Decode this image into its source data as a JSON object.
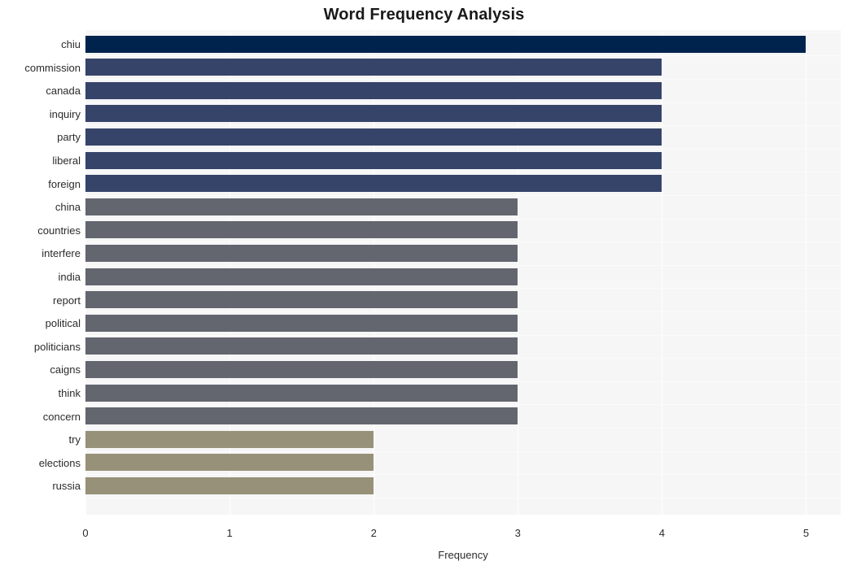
{
  "chart_data": {
    "type": "bar",
    "orientation": "horizontal",
    "title": "Word Frequency Analysis",
    "xlabel": "Frequency",
    "ylabel": "",
    "xlim": [
      0,
      5.24
    ],
    "xticks": [
      "0",
      "1",
      "2",
      "3",
      "4",
      "5"
    ],
    "xtick_values": [
      0,
      1,
      2,
      3,
      4,
      5
    ],
    "grid": true,
    "grid_axis": "both",
    "legend": "none",
    "categories": [
      "chiu",
      "commission",
      "canada",
      "inquiry",
      "party",
      "liberal",
      "foreign",
      "china",
      "countries",
      "interfere",
      "india",
      "report",
      "political",
      "politicians",
      "caigns",
      "think",
      "concern",
      "try",
      "elections",
      "russia"
    ],
    "values": [
      5,
      4,
      4,
      4,
      4,
      4,
      4,
      3,
      3,
      3,
      3,
      3,
      3,
      3,
      3,
      3,
      3,
      2,
      2,
      2
    ],
    "bar_colors": [
      "#00234d",
      "#374469",
      "#374469",
      "#374469",
      "#374469",
      "#374469",
      "#374469",
      "#63666f",
      "#63666f",
      "#63666f",
      "#63666f",
      "#63666f",
      "#63666f",
      "#63666f",
      "#63666f",
      "#63666f",
      "#63666f",
      "#98917a",
      "#98917a",
      "#98917a"
    ],
    "plot_background": "#f6f6f7",
    "figure_background": "#ffffff",
    "gridline_color": "#ffffff",
    "text_color": "#2b2b2b"
  }
}
